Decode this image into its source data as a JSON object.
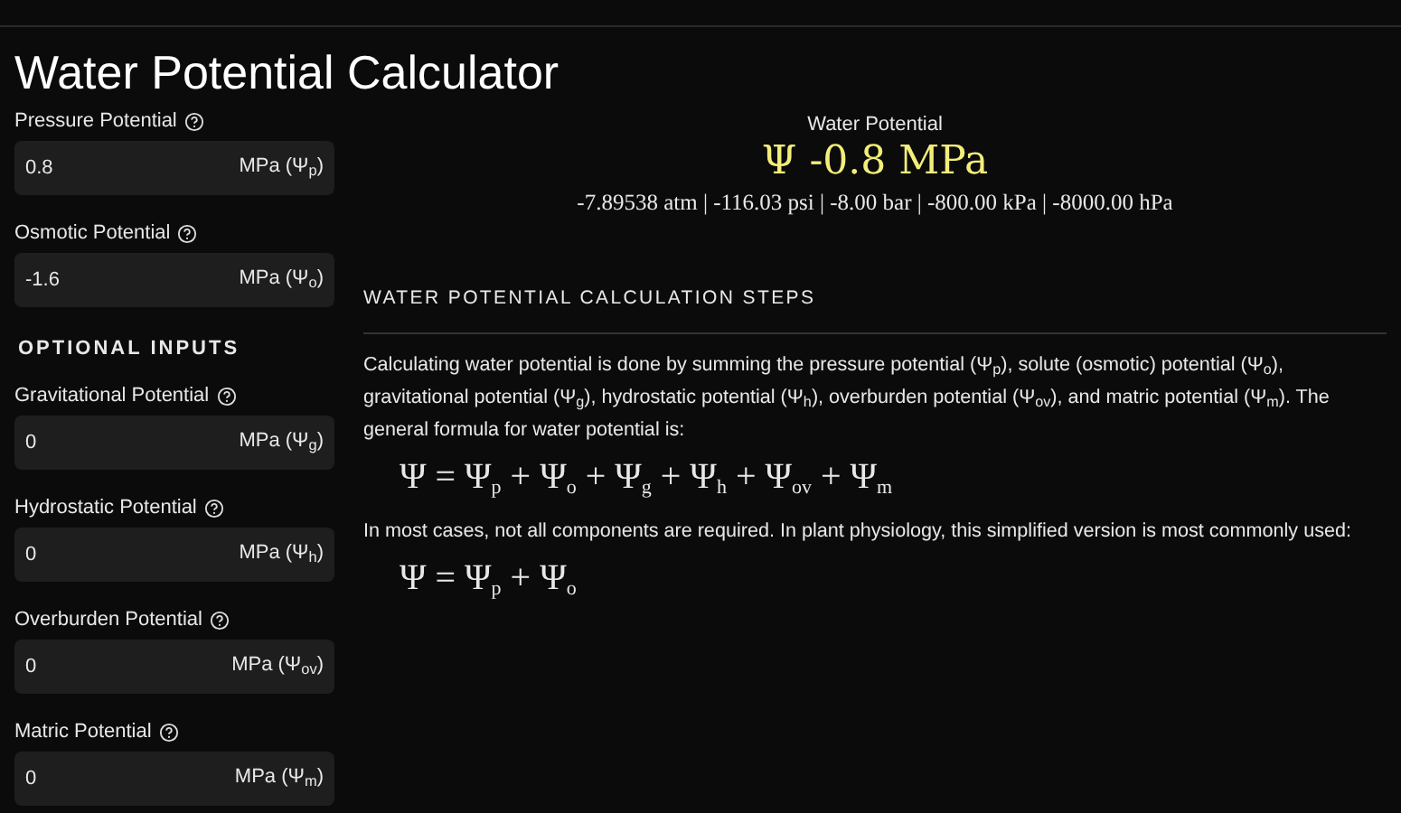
{
  "title": "Water Potential Calculator",
  "inputs": [
    {
      "label": "Pressure Potential",
      "value": "0.8",
      "unit": "MPa (Ψ$_{p}$)"
    },
    {
      "label": "Osmotic Potential",
      "value": "-1.6",
      "unit": "MPa (Ψ$_{o}$)"
    }
  ],
  "optional_heading": "OPTIONAL INPUTS",
  "optional_inputs": [
    {
      "label": "Gravitational Potential",
      "value": "0",
      "unit": "MPa (Ψ$_{g}$)"
    },
    {
      "label": "Hydrostatic Potential",
      "value": "0",
      "unit": "MPa (Ψ$_{h}$)"
    },
    {
      "label": "Overburden Potential",
      "value": "0",
      "unit": "MPa (Ψ$_{ov}$)"
    },
    {
      "label": "Matric Potential",
      "value": "0",
      "unit": "MPa (Ψ$_{m}$)"
    }
  ],
  "result": {
    "label": "Water Potential",
    "value": "Ψ -0.8 MPa",
    "conversions": "-7.89538 atm | -116.03 psi | -8.00 bar | -800.00 kPa | -8000.00 hPa"
  },
  "steps": {
    "heading": "WATER POTENTIAL CALCULATION STEPS",
    "blocks": [
      {
        "kind": "text",
        "text": "Calculating water potential is done by summing the pressure potential (Ψ$_{p}$), solute (osmotic) potential (Ψ$_{o}$), gravitational potential (Ψ$_{g}$), hydrostatic potential (Ψ$_{h}$), overburden potential (Ψ$_{ov}$), and matric potential (Ψ$_{m}$). The general formula for water potential is:"
      },
      {
        "kind": "formula",
        "text": "Ψ = Ψ$_{p}$ + Ψ$_{o}$ + Ψ$_{g}$ + Ψ$_{h}$ + Ψ$_{ov}$ + Ψ$_{m}$"
      },
      {
        "kind": "text",
        "text": "In most cases, not all components are required. In plant physiology, this simplified version is most commonly used:"
      },
      {
        "kind": "formula",
        "text": "Ψ = Ψ$_{p}$ + Ψ$_{o}$"
      }
    ]
  }
}
